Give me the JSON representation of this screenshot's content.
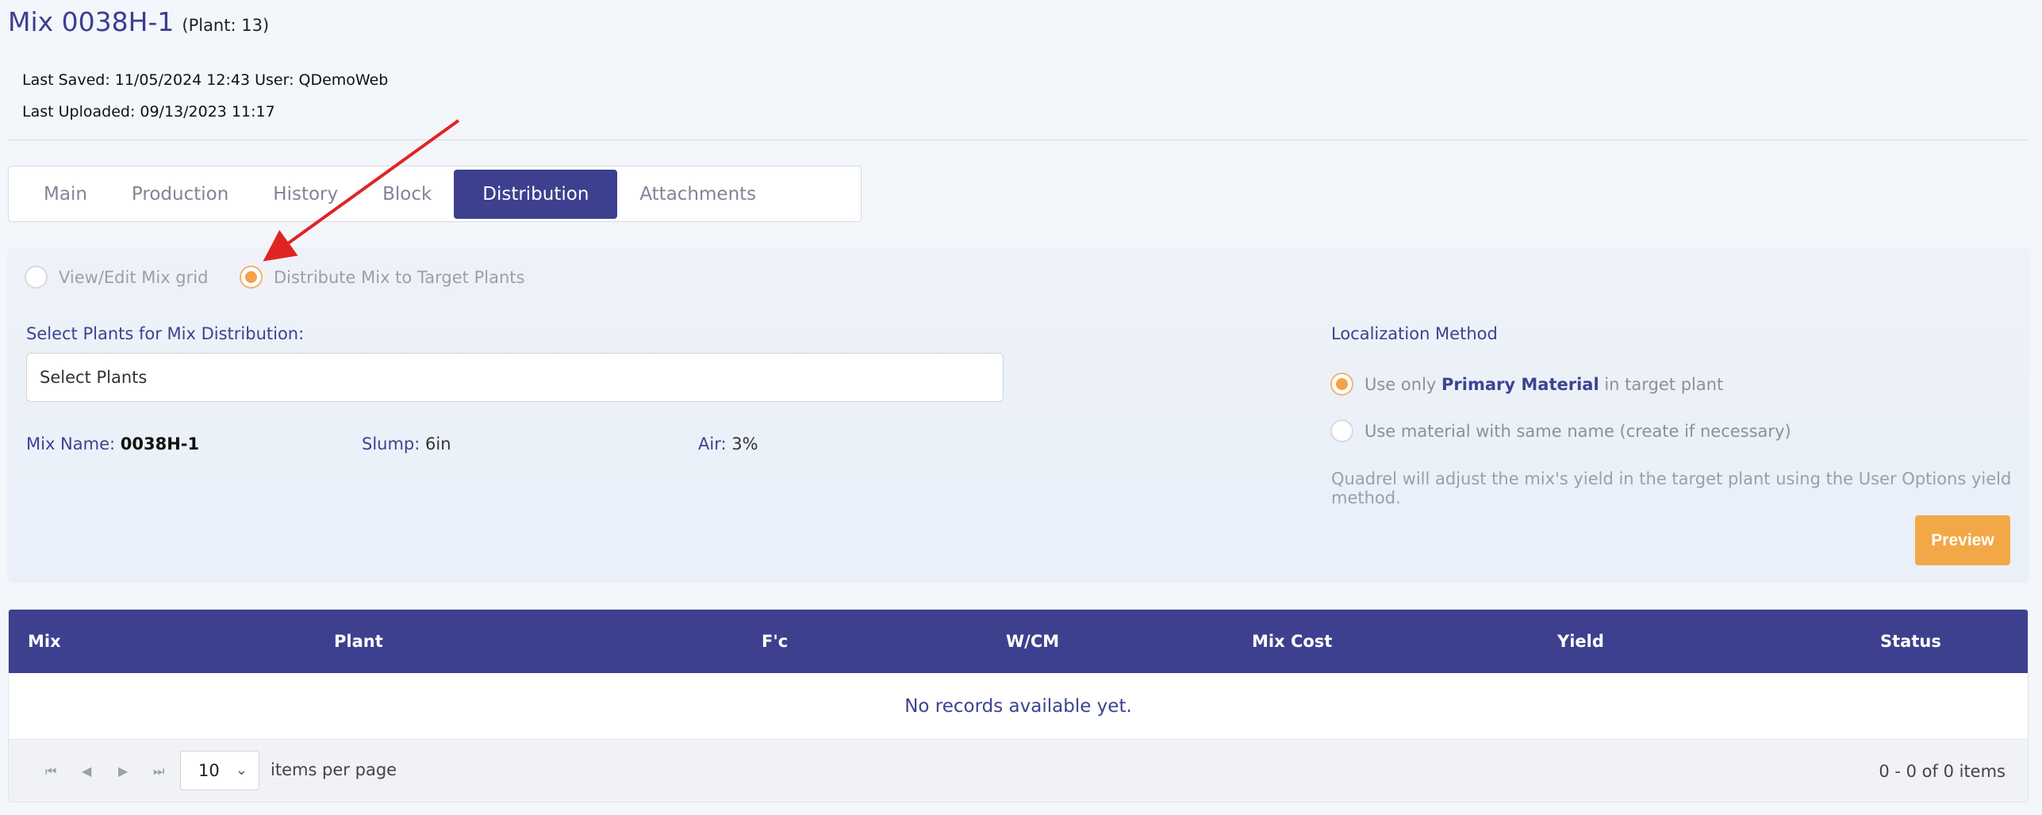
{
  "header": {
    "mix_title": "Mix 0038H-1",
    "plant_label": "(Plant: 13)",
    "last_saved": "Last Saved: 11/05/2024 12:43 User: QDemoWeb",
    "last_uploaded": "Last Uploaded: 09/13/2023 11:17"
  },
  "tabs": [
    {
      "label": "Main"
    },
    {
      "label": "Production"
    },
    {
      "label": "History"
    },
    {
      "label": "Block"
    },
    {
      "label": "Distribution",
      "active": true
    },
    {
      "label": "Attachments"
    }
  ],
  "mode": {
    "option_view_edit": "View/Edit Mix grid",
    "option_distribute": "Distribute Mix to Target Plants",
    "selected": "Distribute Mix to Target Plants"
  },
  "plants": {
    "label": "Select Plants for Mix Distribution:",
    "placeholder": "Select Plants"
  },
  "mix_info": {
    "name_label": "Mix Name:",
    "name_value": "0038H-1",
    "slump_label": "Slump:",
    "slump_value": "6in",
    "air_label": "Air:",
    "air_value": "3%"
  },
  "localization": {
    "title": "Localization Method",
    "opt1_prefix": "Use only",
    "opt1_bold": "Primary Material",
    "opt1_suffix": "in target plant",
    "opt2": "Use material with same name (create if necessary)",
    "note": "Quadrel will adjust the mix's yield in the target plant using the User Options yield method.",
    "selected": "primary"
  },
  "preview_label": "Preview",
  "grid": {
    "columns": [
      "Mix",
      "Plant",
      "F'c",
      "W/CM",
      "Mix Cost",
      "Yield",
      "Status"
    ],
    "empty_message": "No records available yet.",
    "page_size": "10",
    "per_page_label": "items per page",
    "count_label": "0 - 0 of 0 items"
  },
  "colors": {
    "primary": "#3c408f",
    "accent": "#f3a847"
  }
}
